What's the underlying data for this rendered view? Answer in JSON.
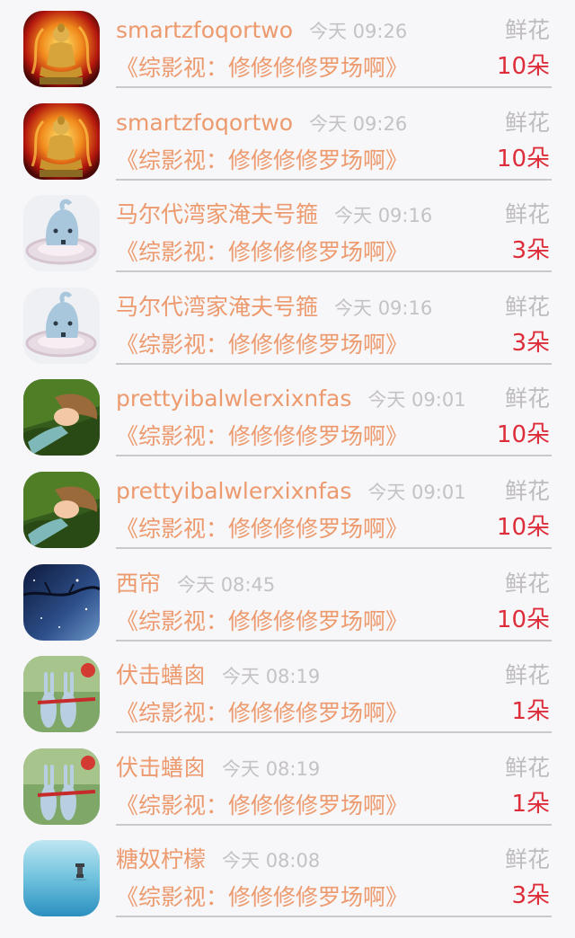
{
  "rows": [
    {
      "name": "smartzfoqortwo",
      "time": "今天 09:26",
      "gift_type": "鲜花",
      "title": "《综影视：修修修修罗场啊》",
      "count": "10朵",
      "avatar": "buddha-avatar"
    },
    {
      "name": "smartzfoqortwo",
      "time": "今天 09:26",
      "gift_type": "鲜花",
      "title": "《综影视：修修修修罗场啊》",
      "count": "10朵",
      "avatar": "buddha-avatar"
    },
    {
      "name": "马尔代湾家淹夫号箍",
      "time": "今天 09:16",
      "gift_type": "鲜花",
      "title": "《综影视：修修修修罗场啊》",
      "count": "3朵",
      "avatar": "whale-avatar"
    },
    {
      "name": "马尔代湾家淹夫号箍",
      "time": "今天 09:16",
      "gift_type": "鲜花",
      "title": "《综影视：修修修修罗场啊》",
      "count": "3朵",
      "avatar": "whale-avatar"
    },
    {
      "name": "prettyibalwlerxixnfas",
      "time": "今天 09:01",
      "gift_type": "鲜花",
      "title": "《综影视：修修修修罗场啊》",
      "count": "10朵",
      "avatar": "girl-on-grass-avatar"
    },
    {
      "name": "prettyibalwlerxixnfas",
      "time": "今天 09:01",
      "gift_type": "鲜花",
      "title": "《综影视：修修修修罗场啊》",
      "count": "10朵",
      "avatar": "girl-on-grass-avatar"
    },
    {
      "name": "西帘",
      "time": "今天 08:45",
      "gift_type": "鲜花",
      "title": "《综影视：修修修修罗场啊》",
      "count": "10朵",
      "avatar": "night-sky-avatar"
    },
    {
      "name": "伏击蟮囪",
      "time": "今天 08:19",
      "gift_type": "鲜花",
      "title": "《综影视：修修修修罗场啊》",
      "count": "1朵",
      "avatar": "rabbits-avatar"
    },
    {
      "name": "伏击蟮囪",
      "time": "今天 08:19",
      "gift_type": "鲜花",
      "title": "《综影视：修修修修罗场啊》",
      "count": "1朵",
      "avatar": "rabbits-avatar"
    },
    {
      "name": "糖奴柠檬",
      "time": "今天 08:08",
      "gift_type": "鲜花",
      "title": "《综影视：修修修修罗场啊》",
      "count": "3朵",
      "avatar": "lake-lantern-avatar"
    }
  ],
  "colors": {
    "name": "#ec9a6e",
    "time": "#c4c2c6",
    "gift_type": "#bdbbbf",
    "count": "#dd2d3a",
    "background": "#f7f6f8"
  }
}
